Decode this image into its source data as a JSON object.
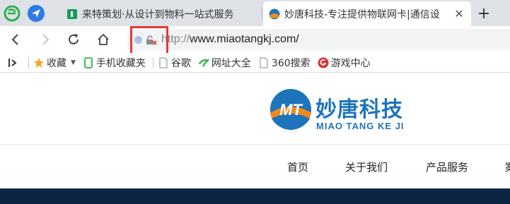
{
  "browser": {
    "tabs": [
      {
        "title": "来特策划·从设计到物料一站式服务",
        "favicon": "green-l-icon",
        "active": false
      },
      {
        "title": "妙唐科技-专注提供物联网卡|通信设",
        "favicon": "mt-logo-icon",
        "active": true
      }
    ],
    "address_bar": {
      "scheme": "http://",
      "host": "www.miaotangkj.com/",
      "security_state": "not-secure"
    },
    "bookmarks": [
      {
        "label": "收藏",
        "icon": "star-icon"
      },
      {
        "label": "手机收藏夹",
        "icon": "phone-icon"
      },
      {
        "label": "谷歌",
        "icon": "page-icon"
      },
      {
        "label": "网址大全",
        "icon": "hao-icon"
      },
      {
        "label": "360搜索",
        "icon": "page-icon"
      },
      {
        "label": "游戏中心",
        "icon": "game-icon"
      }
    ]
  },
  "site": {
    "logo": {
      "cn": "妙唐科技",
      "en": "MIAO TANG KE JI",
      "mark": "MT"
    },
    "menu": [
      "首页",
      "关于我们",
      "产品服务",
      "案"
    ]
  },
  "colors": {
    "brand_blue": "#1e74bb",
    "brand_orange": "#f08a1c",
    "highlight_red": "#e53935",
    "banner_navy": "#0d2444"
  }
}
